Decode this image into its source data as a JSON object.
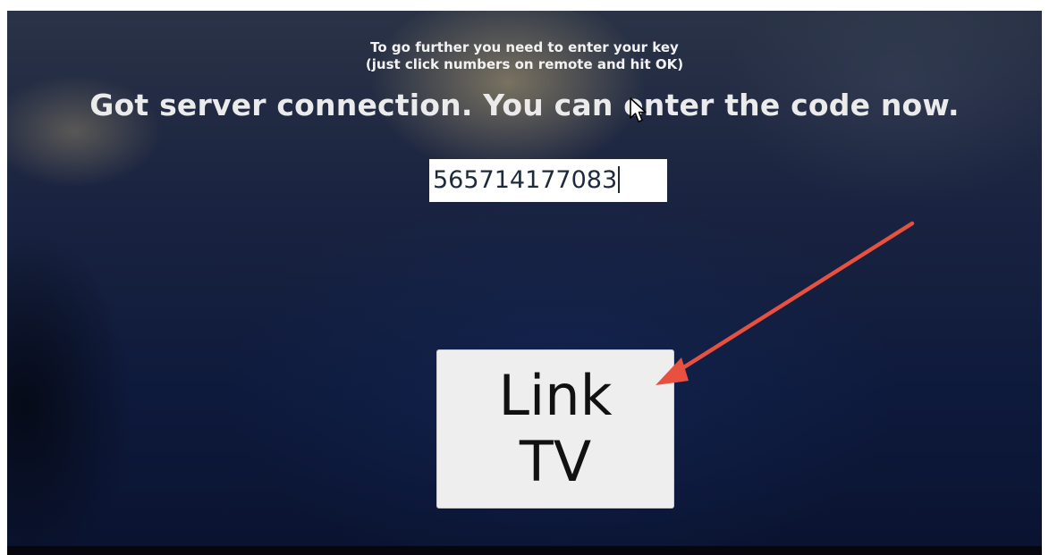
{
  "screen": {
    "instructions": {
      "line1": "To go further you need to enter your key",
      "line2": "(just click numbers on remote and hit OK)"
    },
    "status_message": "Got server connection. You can enter the code now.",
    "code_input": {
      "value": "565714177083"
    },
    "link_button": {
      "line1": "Link",
      "line2": "TV"
    }
  },
  "annotation": {
    "arrow_color": "#e8513f",
    "arrow_target": "link-tv-button"
  },
  "icons": {
    "cursor": "mouse-pointer-icon",
    "arrow": "red-arrow-icon"
  },
  "colors": {
    "screen_background": "#0e1a3c",
    "text": "#f2f2f2",
    "button_background": "#eeeeee",
    "arrow": "#e8513f"
  }
}
